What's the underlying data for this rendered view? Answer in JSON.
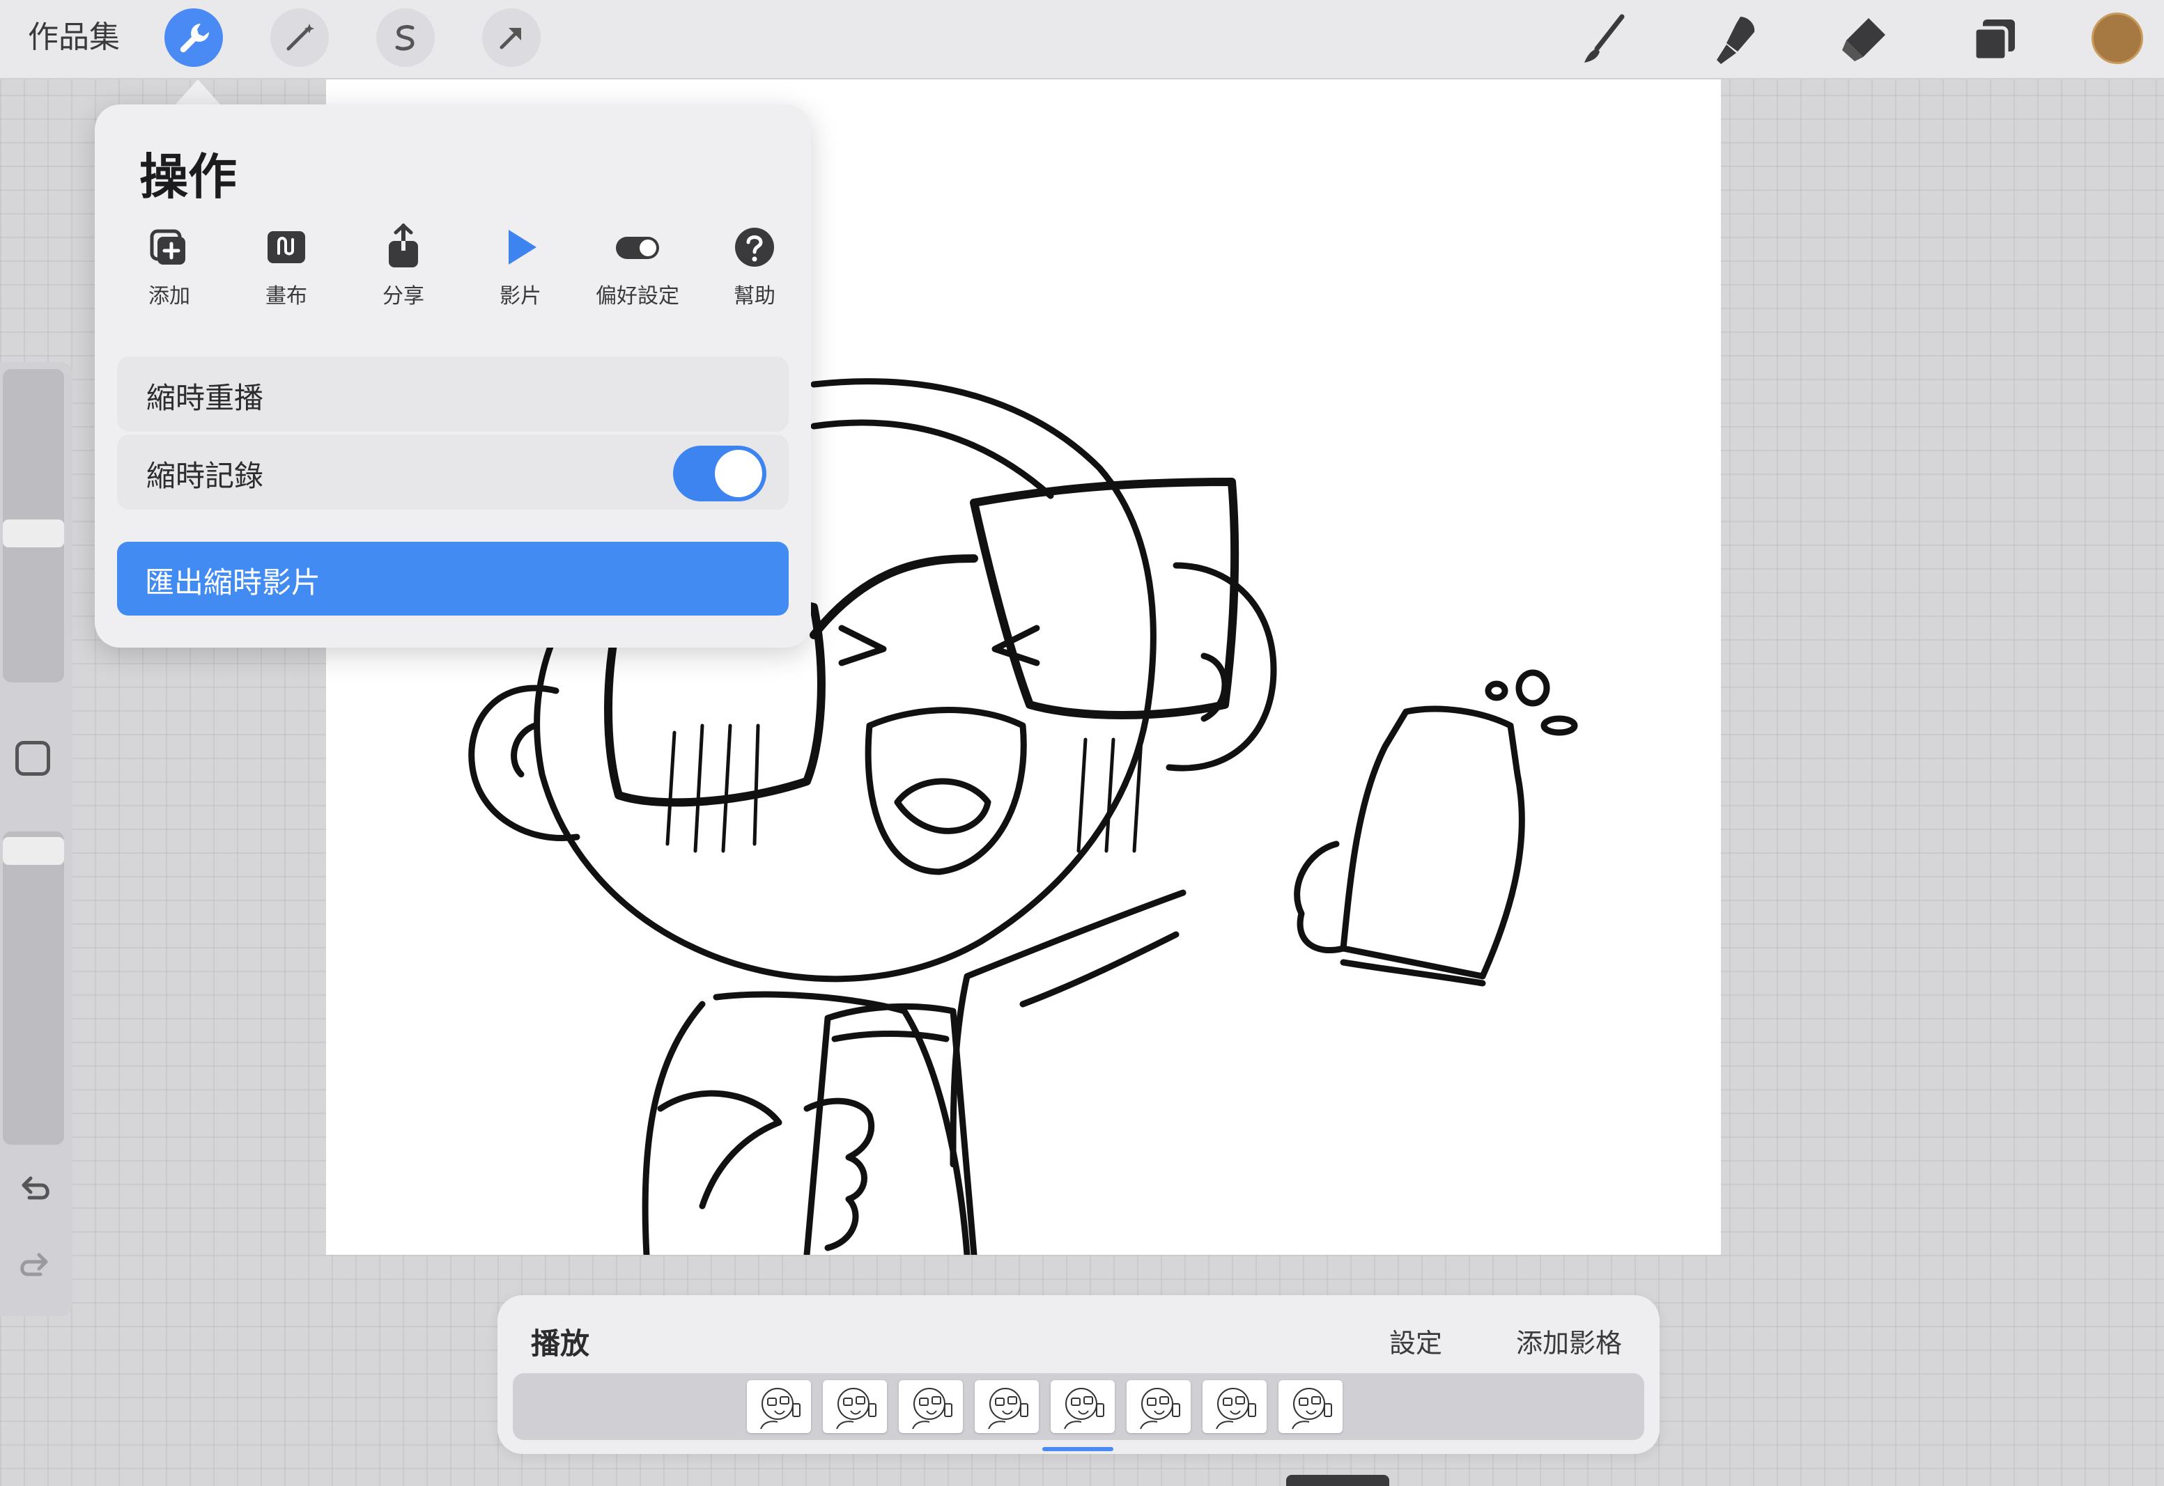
{
  "app": {
    "gallery_label": "作品集"
  },
  "toolbar_left": [
    {
      "name": "actions-wrench-icon",
      "active": true
    },
    {
      "name": "adjustments-wand-icon",
      "active": false
    },
    {
      "name": "selection-s-icon",
      "active": false
    },
    {
      "name": "transform-arrow-icon",
      "active": false
    }
  ],
  "toolbar_right": [
    "brush-icon",
    "smudge-icon",
    "eraser-icon",
    "layers-icon"
  ],
  "colors": {
    "accent": "#4a8af4",
    "current_color": "#a57941",
    "toolbar_bg": "#e9e9ec"
  },
  "actions_panel": {
    "title": "操作",
    "tabs": [
      {
        "label": "添加",
        "icon": "add-icon"
      },
      {
        "label": "畫布",
        "icon": "canvas-icon"
      },
      {
        "label": "分享",
        "icon": "share-icon"
      },
      {
        "label": "影片",
        "icon": "video-play-icon",
        "active": true
      },
      {
        "label": "偏好設定",
        "icon": "preferences-toggle-icon"
      },
      {
        "label": "幫助",
        "icon": "help-icon"
      }
    ],
    "rows": {
      "timelapse_replay": "縮時重播",
      "timelapse_record": "縮時記錄",
      "timelapse_record_on": true
    },
    "export_button": "匯出縮時影片"
  },
  "animation_panel": {
    "title": "播放",
    "settings": "設定",
    "add_frame": "添加影格",
    "frame_count": 8
  }
}
